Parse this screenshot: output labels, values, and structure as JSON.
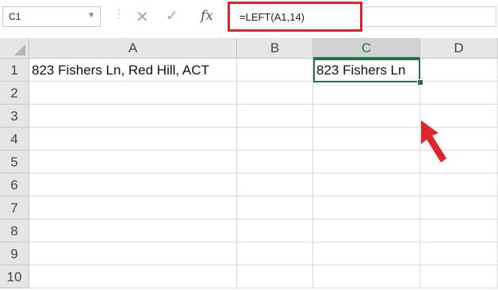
{
  "formula_bar": {
    "name_box": "C1",
    "cancel_icon": "✕",
    "enter_icon": "✓",
    "fx_label": "fx",
    "formula": "=LEFT(A1,14)"
  },
  "columns": [
    "A",
    "B",
    "C",
    "D"
  ],
  "selected_column": "C",
  "rows": [
    "1",
    "2",
    "3",
    "4",
    "5",
    "6",
    "7",
    "8",
    "9",
    "10"
  ],
  "cells": {
    "A1": "823 Fishers Ln, Red Hill, ACT",
    "C1": "823 Fishers Ln"
  },
  "colors": {
    "highlight_border": "#e1232b",
    "selection": "#217346",
    "arrow": "#e1232b"
  }
}
